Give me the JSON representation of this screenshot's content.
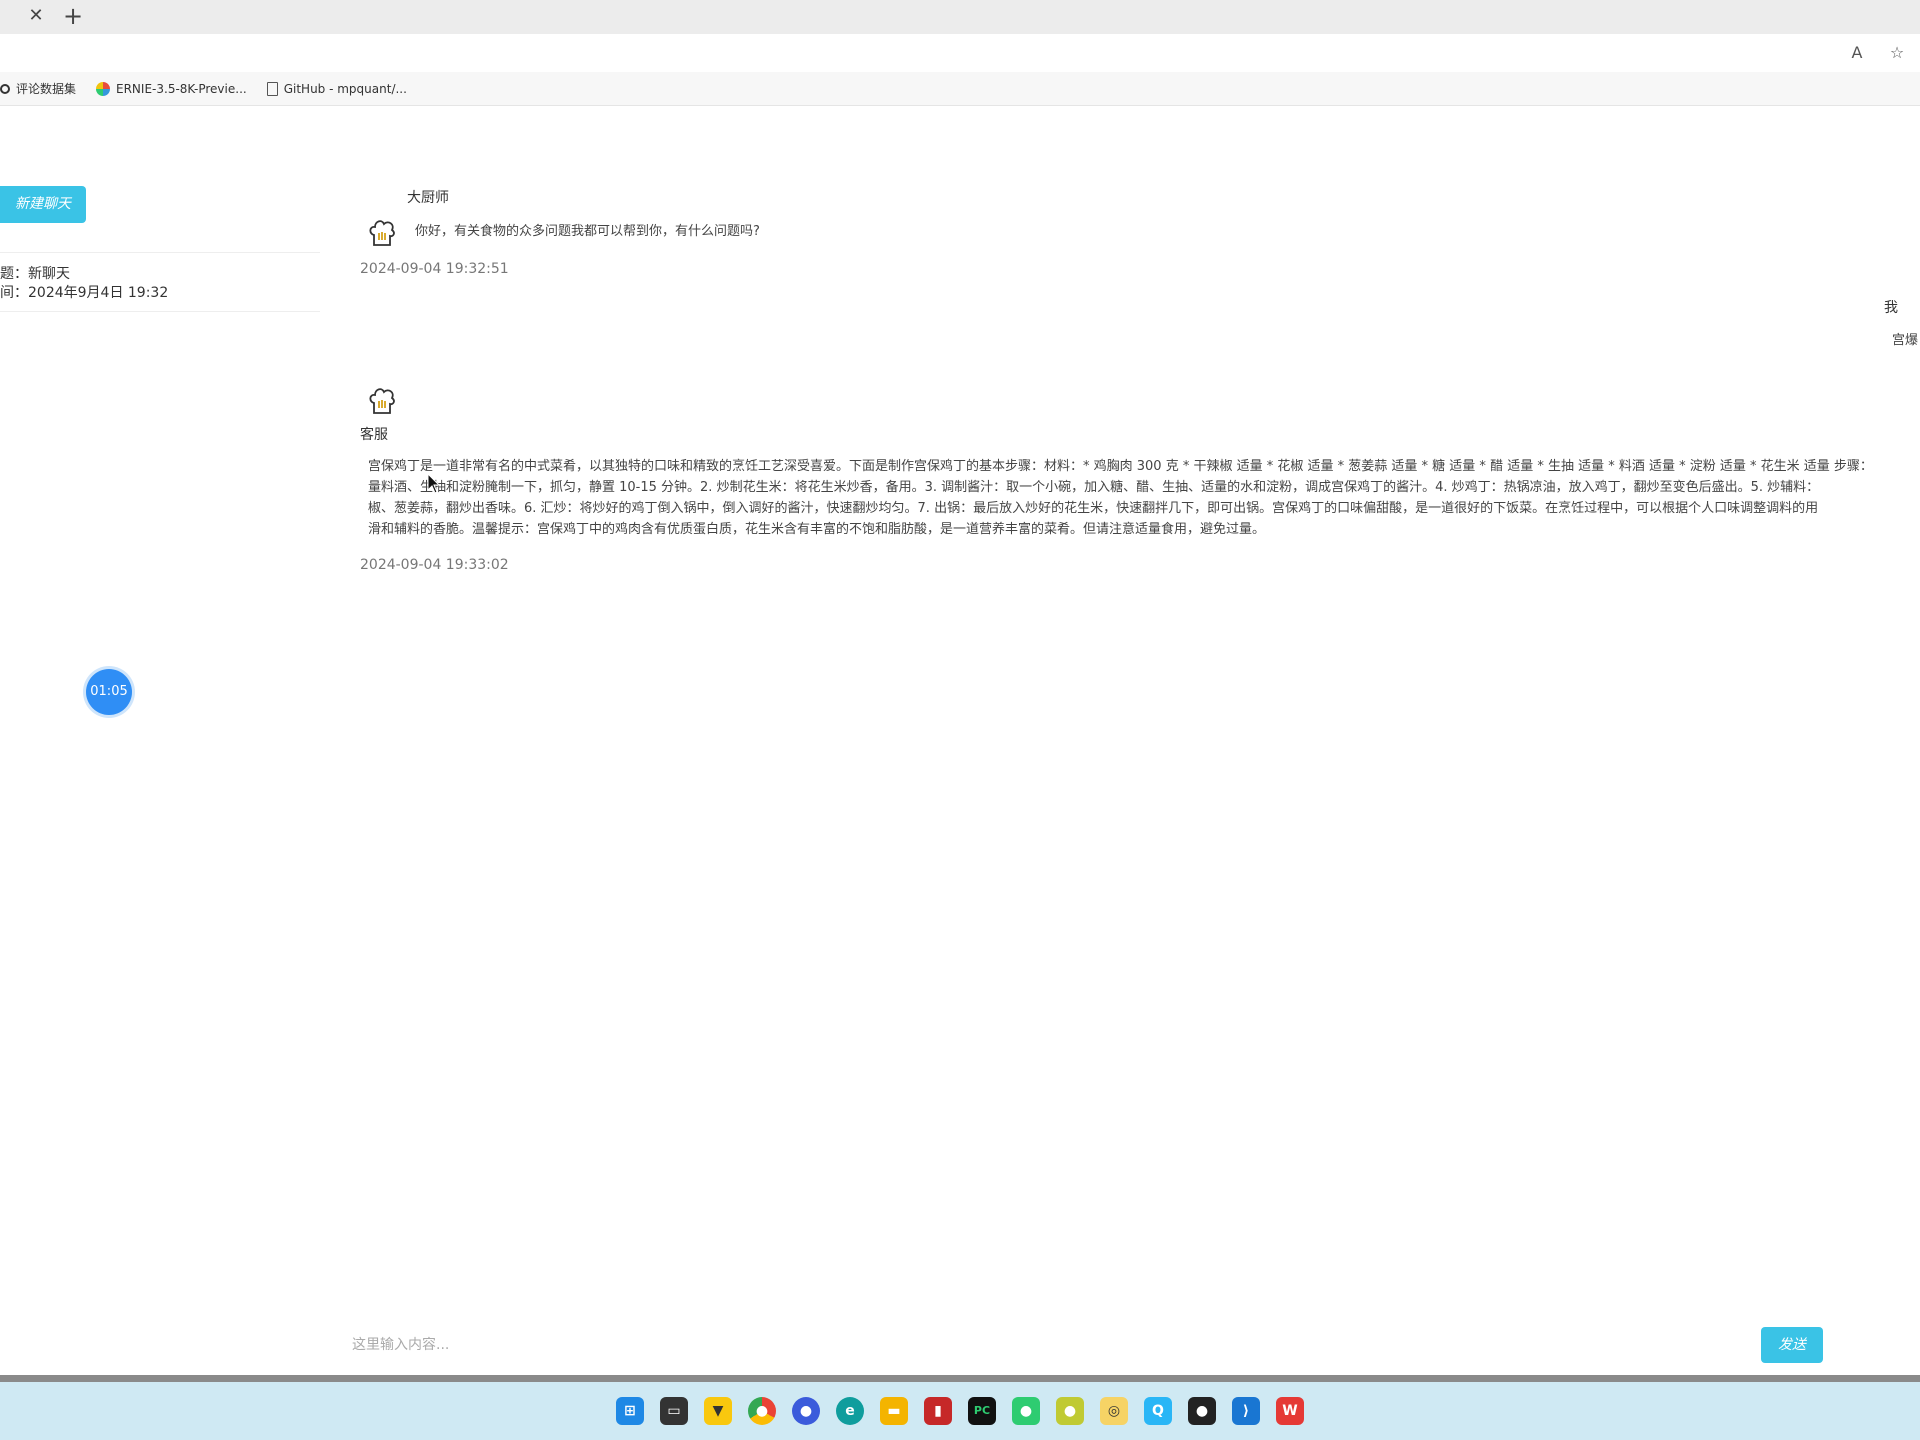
{
  "browser": {
    "bookmarks": [
      {
        "label": "评论数据集",
        "icon": "circle-icon"
      },
      {
        "label": "ERNIE-3.5-8K-Previe...",
        "icon": "ernie-icon"
      },
      {
        "label": "GitHub - mpquant/...",
        "icon": "document-icon"
      }
    ]
  },
  "sidebar": {
    "new_chat_label": "新建聊天",
    "conversation": {
      "title_line": "题：新聊天",
      "time_line": "间：2024年9月4日 19:32"
    },
    "timer": "01:05"
  },
  "chat": {
    "bot_name": "大厨师",
    "greeting": "你好，有关食物的众多问题我都可以帮到你，有什么问题吗?",
    "greeting_time": "2024-09-04 19:32:51",
    "user_name": "我",
    "user_msg": "宫爆",
    "reply_name": "客服",
    "reply_lines": [
      "宫保鸡丁是一道非常有名的中式菜肴，以其独特的口味和精致的烹饪工艺深受喜爱。下面是制作宫保鸡丁的基本步骤：材料：* 鸡胸肉 300 克 * 干辣椒 适量 * 花椒 适量 * 葱姜蒜 适量 * 糖 适量 * 醋 适量 * 生抽 适量 * 料酒 适量 * 淀粉 适量 * 花生米 适量 步骤：",
      "量料酒、生抽和淀粉腌制一下，抓匀，静置 10-15 分钟。2. 炒制花生米：将花生米炒香，备用。3. 调制酱汁：取一个小碗，加入糖、醋、生抽、适量的水和淀粉，调成宫保鸡丁的酱汁。4. 炒鸡丁：热锅凉油，放入鸡丁，翻炒至变色后盛出。5. 炒辅料：",
      "椒、葱姜蒜，翻炒出香味。6. 汇炒：将炒好的鸡丁倒入锅中，倒入调好的酱汁，快速翻炒均匀。7. 出锅：最后放入炒好的花生米，快速翻拌几下，即可出锅。宫保鸡丁的口味偏甜酸，是一道很好的下饭菜。在烹饪过程中，可以根据个人口味调整调料的用",
      "滑和辅料的香脆。温馨提示：宫保鸡丁中的鸡肉含有优质蛋白质，花生米含有丰富的不饱和脂肪酸，是一道营养丰富的菜肴。但请注意适量食用，避免过量。"
    ],
    "reply_time": "2024-09-04 19:33:02"
  },
  "composer": {
    "placeholder": "这里输入内容...",
    "send_label": "发送"
  },
  "taskbar": {
    "icons": [
      "windows-start-icon",
      "task-view-icon",
      "vpn-icon",
      "chrome-icon",
      "browser-icon",
      "edge-icon",
      "file-explorer-icon",
      "app-icon",
      "pycharm-icon",
      "wechat-icon",
      "lemon-icon",
      "cat-icon",
      "search-app-icon",
      "qq-icon",
      "vscode-icon",
      "wps-icon"
    ]
  }
}
